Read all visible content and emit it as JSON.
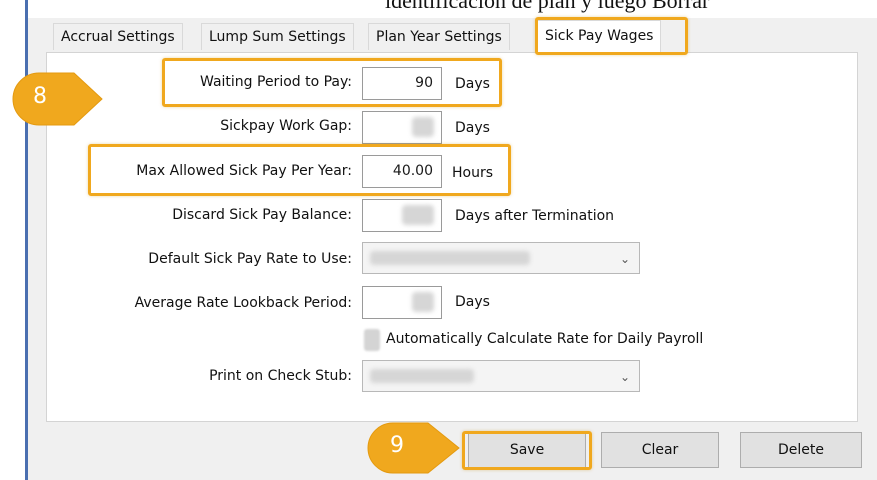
{
  "background_text": "identificación de plan y luego Borrar",
  "tabs": [
    {
      "label": "Accrual Settings"
    },
    {
      "label": "Lump Sum Settings"
    },
    {
      "label": "Plan Year Settings"
    },
    {
      "label": "Sick Pay Wages"
    }
  ],
  "fields": {
    "waiting_period": {
      "label": "Waiting Period to Pay:",
      "value": "90",
      "unit": "Days"
    },
    "work_gap": {
      "label": "Sickpay Work Gap:",
      "value": "",
      "unit": "Days"
    },
    "max_allowed": {
      "label": "Max Allowed Sick Pay Per Year:",
      "value": "40.00",
      "unit": "Hours"
    },
    "discard_balance": {
      "label": "Discard Sick Pay Balance:",
      "value": "",
      "unit": "Days after Termination"
    },
    "default_rate": {
      "label": "Default Sick Pay Rate to Use:",
      "value": ""
    },
    "lookback": {
      "label": "Average Rate Lookback Period:",
      "value": "",
      "unit": "Days"
    },
    "auto_calc": {
      "label": "Automatically Calculate Rate for Daily Payroll"
    },
    "print_stub": {
      "label": "Print on Check Stub:",
      "value": ""
    }
  },
  "buttons": {
    "save": "Save",
    "clear": "Clear",
    "delete": "Delete"
  },
  "markers": {
    "step8": "8",
    "step9": "9"
  },
  "colors": {
    "highlight": "#f0a81e",
    "marker": "#f0a81e"
  }
}
